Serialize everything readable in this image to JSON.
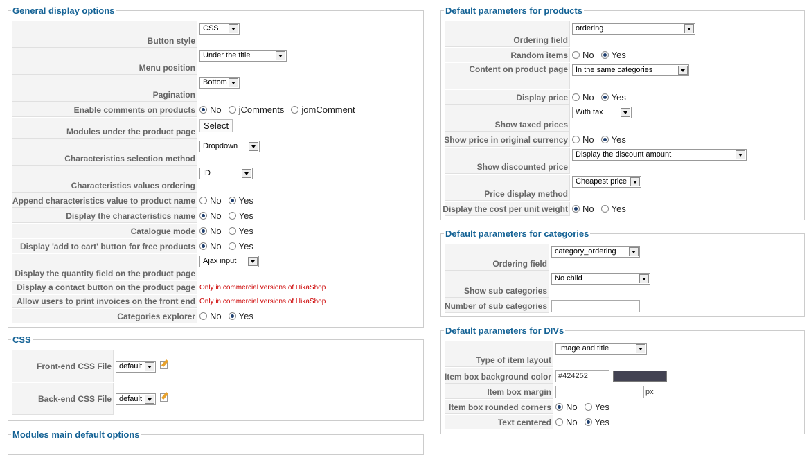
{
  "general": {
    "title": "General display options",
    "button_style": {
      "label": "Button style",
      "value": "CSS"
    },
    "menu_position": {
      "label": "Menu position",
      "value": "Under the title"
    },
    "pagination": {
      "label": "Pagination",
      "value": "Bottom"
    },
    "comments": {
      "label": "Enable comments on products",
      "options": [
        "No",
        "jComments",
        "jomComment"
      ]
    },
    "modules": {
      "label": "Modules under the product page",
      "button": "Select"
    },
    "char_method": {
      "label": "Characteristics selection method",
      "value": "Dropdown"
    },
    "char_ordering": {
      "label": "Characteristics values ordering",
      "value": "ID"
    },
    "append_char": {
      "label": "Append characteristics value to product name"
    },
    "display_char": {
      "label": "Display the characteristics name"
    },
    "catalogue": {
      "label": "Catalogue mode"
    },
    "add_cart": {
      "label": "Display 'add to cart' button for free products"
    },
    "quantity": {
      "label": "Display the quantity field on the product page",
      "value": "Ajax input"
    },
    "contact": {
      "label": "Display a contact button on the product page",
      "note": "Only in commercial versions of HikaShop"
    },
    "invoices": {
      "label": "Allow users to print invoices on the front end",
      "note": "Only in commercial versions of HikaShop"
    },
    "cat_explorer": {
      "label": "Categories explorer"
    }
  },
  "yesno": {
    "no": "No",
    "yes": "Yes"
  },
  "css": {
    "title": "CSS",
    "frontend": {
      "label": "Front-end CSS File",
      "value": "default"
    },
    "backend": {
      "label": "Back-end CSS File",
      "value": "default"
    }
  },
  "modules_main": {
    "title": "Modules main default options"
  },
  "products": {
    "title": "Default parameters for products",
    "ordering": {
      "label": "Ordering field",
      "value": "ordering"
    },
    "random": {
      "label": "Random items"
    },
    "content": {
      "label": "Content on product page",
      "value": "In the same categories"
    },
    "price": {
      "label": "Display price"
    },
    "taxed": {
      "label": "Show taxed prices",
      "value": "With tax"
    },
    "orig_currency": {
      "label": "Show price in original currency"
    },
    "discounted": {
      "label": "Show discounted price",
      "value": "Display the discount amount"
    },
    "price_method": {
      "label": "Price display method",
      "value": "Cheapest price"
    },
    "unit_weight": {
      "label": "Display the cost per unit weight"
    }
  },
  "categories": {
    "title": "Default parameters for categories",
    "ordering": {
      "label": "Ordering field",
      "value": "category_ordering"
    },
    "sub": {
      "label": "Show sub categories",
      "value": "No child"
    },
    "num_sub": {
      "label": "Number of sub categories",
      "value": ""
    }
  },
  "divs": {
    "title": "Default parameters for DIVs",
    "layout": {
      "label": "Type of item layout",
      "value": "Image and title"
    },
    "bg": {
      "label": "Item box background color",
      "value": "#424252",
      "color": "#424252"
    },
    "margin": {
      "label": "Item box margin",
      "value": "",
      "unit": "px"
    },
    "rounded": {
      "label": "Item box rounded corners"
    },
    "centered": {
      "label": "Text centered"
    }
  }
}
